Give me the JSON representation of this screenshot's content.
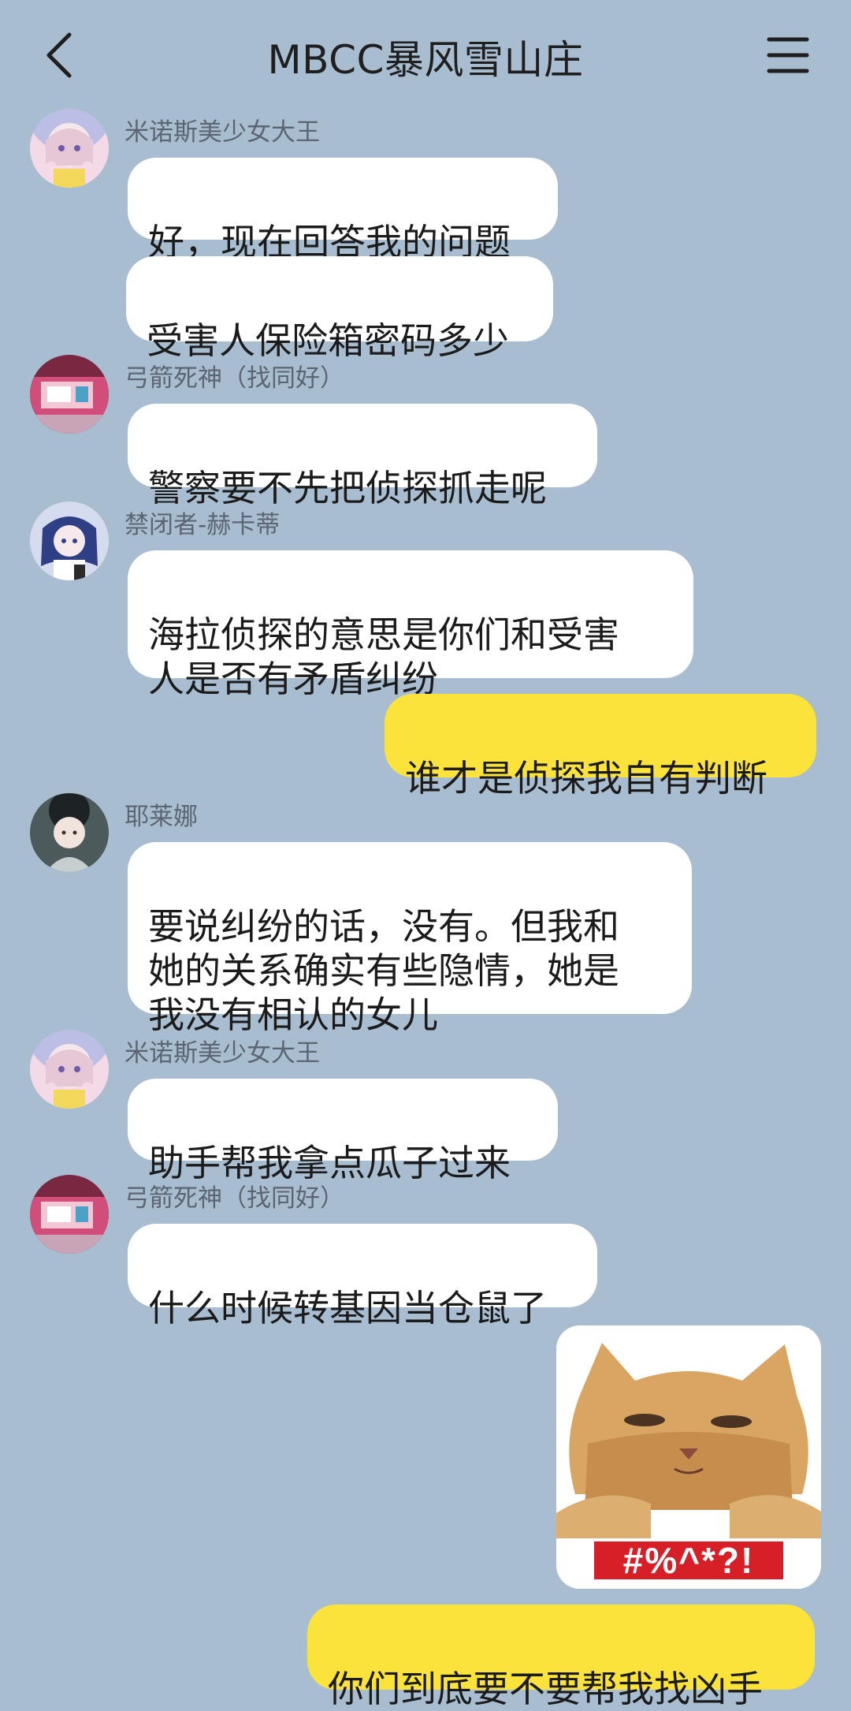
{
  "header": {
    "title": "MBCC暴风雪山庄",
    "back_icon": "chevron-left-icon",
    "menu_icon": "hamburger-menu-icon"
  },
  "messages": [
    {
      "sender": "米诺斯美少女大王",
      "text": "好，现在回答我的问题"
    },
    {
      "text": "受害人保险箱密码多少"
    },
    {
      "sender": "弓箭死神（找同好）",
      "text": "警察要不先把侦探抓走呢"
    },
    {
      "sender": "禁闭者-赫卡蒂",
      "text": "海拉侦探的意思是你们和受害\n人是否有矛盾纠纷"
    },
    {
      "text": "谁才是侦探我自有判断",
      "own": true
    },
    {
      "sender": "耶莱娜",
      "text": "要说纠纷的话，没有。但我和\n她的关系确实有些隐情，她是\n我没有相认的女儿"
    },
    {
      "sender": "米诺斯美少女大王",
      "text": "助手帮我拿点瓜子过来"
    },
    {
      "sender": "弓箭死神（找同好）",
      "text": "什么时候转基因当仓鼠了"
    },
    {
      "sticker_caption": "#%^*?!",
      "own": true
    },
    {
      "text": "你们到底要不要帮我找凶手",
      "own": true
    }
  ],
  "colors": {
    "background": "#a9bdd0",
    "own_bubble": "#fbe33b",
    "other_bubble": "#ffffff"
  }
}
